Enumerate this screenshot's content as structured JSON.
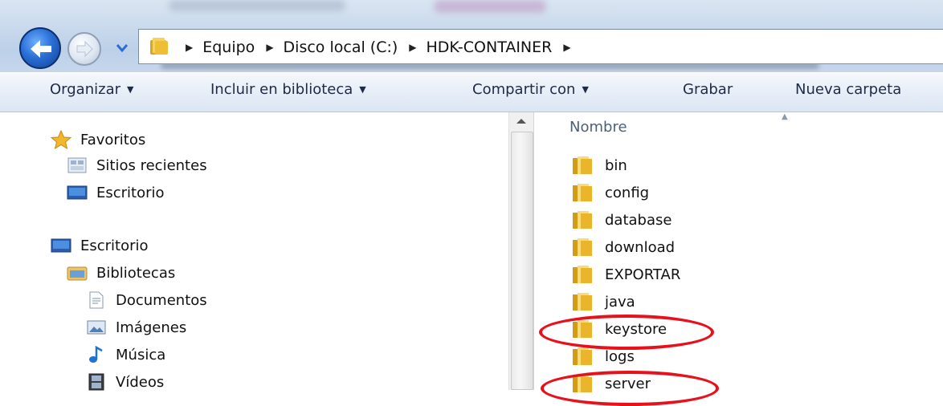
{
  "address_bar": {
    "crumbs": [
      "Equipo",
      "Disco local (C:)",
      "HDK-CONTAINER"
    ]
  },
  "toolbar": {
    "organize": "Organizar",
    "include_library": "Incluir en biblioteca",
    "share_with": "Compartir con",
    "burn": "Grabar",
    "new_folder": "Nueva carpeta"
  },
  "nav_tree": {
    "favorites": "Favoritos",
    "recent_places": "Sitios recientes",
    "desktop_fav": "Escritorio",
    "desktop": "Escritorio",
    "libraries": "Bibliotecas",
    "documents": "Documentos",
    "pictures": "Imágenes",
    "music": "Música",
    "videos": "Vídeos"
  },
  "file_list": {
    "column_name": "Nombre",
    "items": [
      "bin",
      "config",
      "database",
      "download",
      "EXPORTAR",
      "java",
      "keystore",
      "logs",
      "server"
    ],
    "highlighted": [
      "keystore",
      "server"
    ]
  },
  "colors": {
    "highlight": "#e8101b",
    "folder": "#e8b92a"
  }
}
